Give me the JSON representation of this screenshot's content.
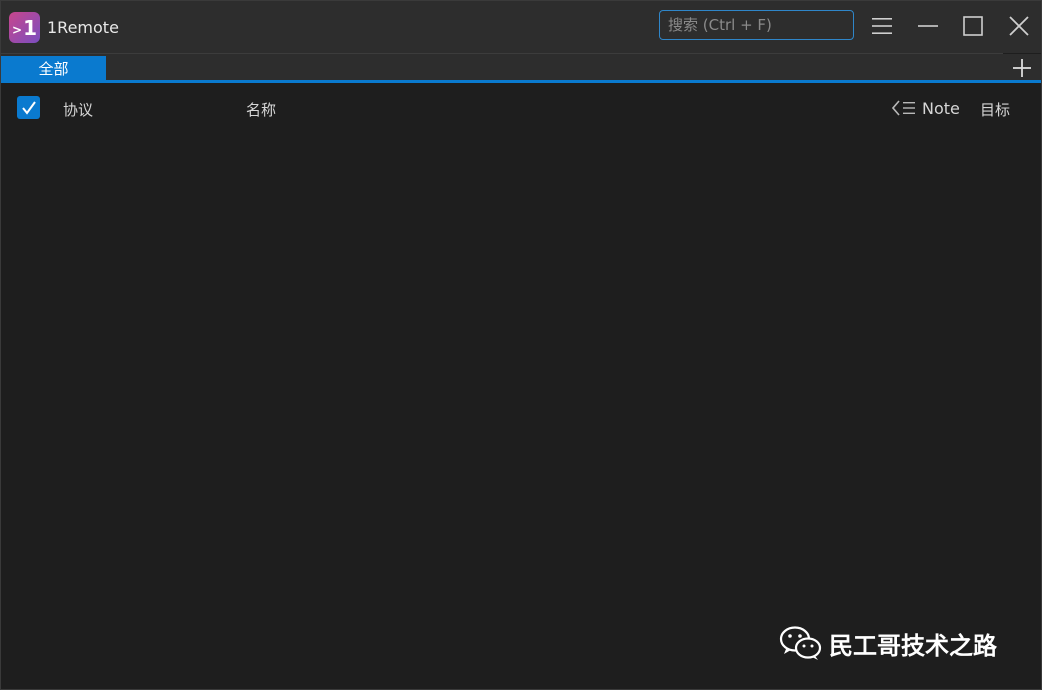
{
  "app": {
    "title": "1Remote",
    "logo_text": "1",
    "logo_prefix": ">"
  },
  "search": {
    "placeholder": "搜索 (Ctrl + F)",
    "value": ""
  },
  "tabs": [
    {
      "label": "全部",
      "active": true
    }
  ],
  "table": {
    "headers": {
      "protocol": "协议",
      "name": "名称",
      "note": "Note",
      "target": "目标"
    },
    "select_all_checked": true,
    "rows": []
  },
  "watermark": {
    "text": "民工哥技术之路"
  },
  "colors": {
    "accent": "#0a7acf",
    "background": "#1e1e1e",
    "titlebar": "#2d2d2d",
    "text": "#d6d6d6"
  },
  "icons": {
    "menu": "menu-icon",
    "minimize": "minimize-icon",
    "maximize": "maximize-icon",
    "close": "close-icon",
    "add": "plus-icon",
    "note_collapse": "collapse-list-icon",
    "checkbox": "check-icon",
    "wechat": "wechat-icon"
  }
}
